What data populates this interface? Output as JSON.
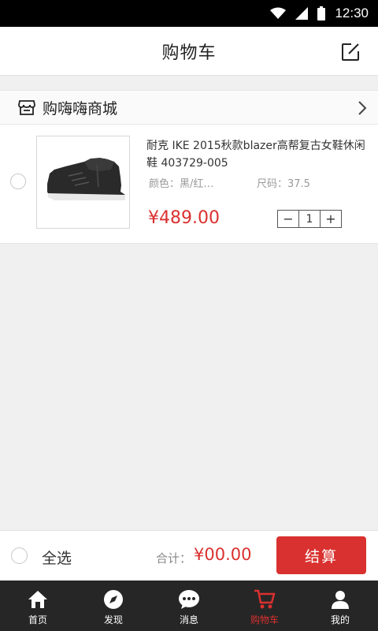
{
  "status_bar": {
    "time": "12:30"
  },
  "header": {
    "title": "购物车"
  },
  "store": {
    "name": "购嗨嗨商城"
  },
  "item": {
    "name": "耐克 IKE 2015秋款blazer高帮复古女鞋休闲鞋 403729-005",
    "color_attr": "颜色：黑/红…",
    "size_attr": "尺码：37.5",
    "price": "¥489.00",
    "quantity": "1",
    "decrement_label": "−",
    "increment_label": "+"
  },
  "checkout": {
    "select_all_label": "全选",
    "total_label": "合计：",
    "total_value": "¥00.00",
    "checkout_label": "结算"
  },
  "tabs": [
    {
      "label": "首页",
      "icon": "home-icon"
    },
    {
      "label": "发现",
      "icon": "compass-icon"
    },
    {
      "label": "消息",
      "icon": "chat-icon"
    },
    {
      "label": "购物车",
      "icon": "cart-icon"
    },
    {
      "label": "我的",
      "icon": "user-icon"
    }
  ],
  "active_tab": "购物车",
  "colors": {
    "accent": "#d9312f",
    "tab_bar": "#262626",
    "status_bar": "#000000"
  }
}
